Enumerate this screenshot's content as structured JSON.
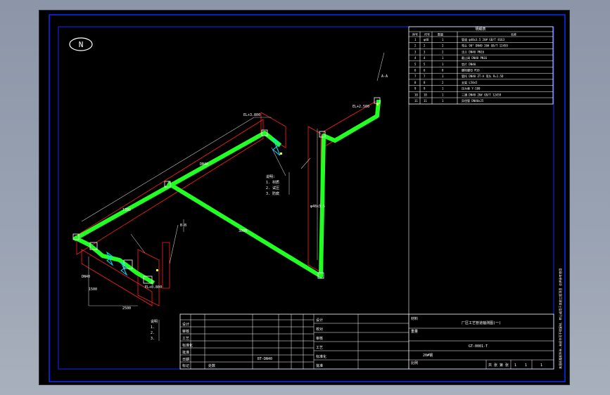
{
  "colors": {
    "pipe": "#22ff22",
    "frame": "#1428ff",
    "lines": "#ffffff",
    "hatch": "#ff2020",
    "dims": "#bfbfbf",
    "accent": "#ffff00"
  },
  "north_symbol": "N",
  "bom": {
    "title": "明细表",
    "headers": [
      "序号",
      "代号",
      "数量",
      "名称"
    ],
    "rows": [
      {
        "no": "1",
        "code": "φ48",
        "qty": "1",
        "name": "管道 φ48x3.5 20# GB/T 8163"
      },
      {
        "no": "2",
        "code": "2",
        "qty": "2",
        "name": "弯头 90° DN40 20# GB/T 12459"
      },
      {
        "no": "3",
        "code": "3",
        "qty": "2",
        "name": "法兰 DN40 PN16"
      },
      {
        "no": "4",
        "code": "4",
        "qty": "1",
        "name": "截止阀 DN40 PN16"
      },
      {
        "no": "5",
        "code": "5",
        "qty": "1",
        "name": "垫片 DN40"
      },
      {
        "no": "6",
        "code": "6",
        "qty": "8",
        "name": "螺栓螺母 M16"
      },
      {
        "no": "7",
        "code": "7",
        "qty": "1",
        "name": "管托 DN40 ZT-A 弯头 R=1.5D"
      },
      {
        "no": "8",
        "code": "8",
        "qty": "2",
        "name": "支架 L50x5"
      },
      {
        "no": "9",
        "code": "9",
        "qty": "1",
        "name": "压力表 Y-100"
      },
      {
        "no": "10",
        "code": "10",
        "qty": "1",
        "name": "三通 DN40 20# GB/T 12459"
      },
      {
        "no": "11",
        "code": "11",
        "qty": "1",
        "name": "异径管 DN40x25"
      }
    ]
  },
  "labels": [
    {
      "id": "l1",
      "text": "EL+3.800"
    },
    {
      "id": "l2",
      "text": "EL+2.500"
    },
    {
      "id": "l3",
      "text": "DN40"
    },
    {
      "id": "l4",
      "text": "1200"
    },
    {
      "id": "l5",
      "text": "3000"
    },
    {
      "id": "l6",
      "text": "φ48x3.5"
    },
    {
      "id": "l7",
      "text": "DN40"
    },
    {
      "id": "l8",
      "text": "2500"
    },
    {
      "id": "l9",
      "text": "EL+0.800"
    },
    {
      "id": "l10",
      "text": "B-B"
    },
    {
      "id": "l11",
      "text": "A-A"
    },
    {
      "id": "l12",
      "text": "1500"
    }
  ],
  "notes_mid": [
    "说明:",
    "1. 材质",
    "2. 试压",
    "3. 防腐"
  ],
  "notes_left": [
    "说明",
    "1.",
    "2.",
    "3."
  ],
  "title_block": {
    "left_labels": [
      "设计",
      "审核",
      "工艺",
      "标准化",
      "批准",
      "日期"
    ],
    "mid_labels": [
      "设计",
      "校对",
      "审核",
      "工艺",
      "标准化",
      "批准"
    ],
    "left_bottom_a": "标记",
    "left_bottom_b": "处数",
    "mid_caption": "BT-DN40",
    "drawing_name": "厂区工艺管道轴测图(一)",
    "label_material": "材料",
    "label_weight": "重量",
    "label_scale": "比例",
    "drawing_no": "GT-0001-T",
    "material": "20#钢",
    "sheet_info": "共 张  第 张",
    "sheet_count": "1",
    "sheet_num": "1",
    "page_total": "1",
    "vertical_note": "本图纸版权所有,未经许可不得复制、转让或用于其他工程项目 仅供参考使用"
  }
}
